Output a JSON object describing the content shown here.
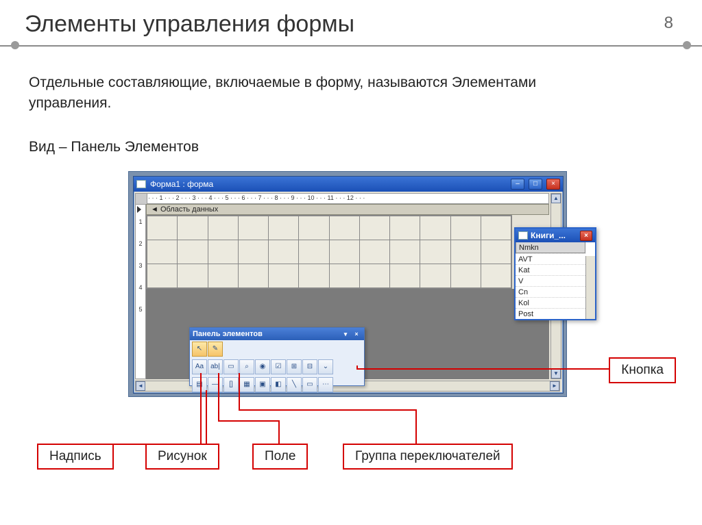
{
  "page": {
    "title": "Элементы управления формы",
    "number": "8",
    "para1": "Отдельные составляющие, включаемые в форму, называются Элементами управления.",
    "para2": "Вид – Панель Элементов"
  },
  "formWindow": {
    "title": "Форма1 : форма",
    "section": "Область данных",
    "ruler": "· · · 1 · · · 2 · · · 3 · · · 4 · · · 5 · · · 6 · · · 7 · · · 8 · · · 9 · · · 10 · · · 11 · · · 12 · · ·"
  },
  "fieldList": {
    "title": "Книги_...",
    "fields": [
      "Nmkn",
      "AVT",
      "Kat",
      "V",
      "Cn",
      "Kol",
      "Post"
    ]
  },
  "toolbox": {
    "title": "Панель элементов",
    "row1": [
      "↖",
      "✎"
    ],
    "row2": [
      "Aa",
      "ab|",
      "▭",
      "⌕",
      "◉",
      "☑",
      "⊞",
      "⊟",
      "⌄"
    ],
    "row3": [
      "▤",
      "—",
      "[]",
      "▦",
      "▣",
      "◧",
      "╲",
      "▭",
      "⋯"
    ]
  },
  "callouts": {
    "button": "Кнопка",
    "label": "Надпись",
    "picture": "Рисунок",
    "field": "Поле",
    "optiongroup": "Группа переключателей"
  }
}
